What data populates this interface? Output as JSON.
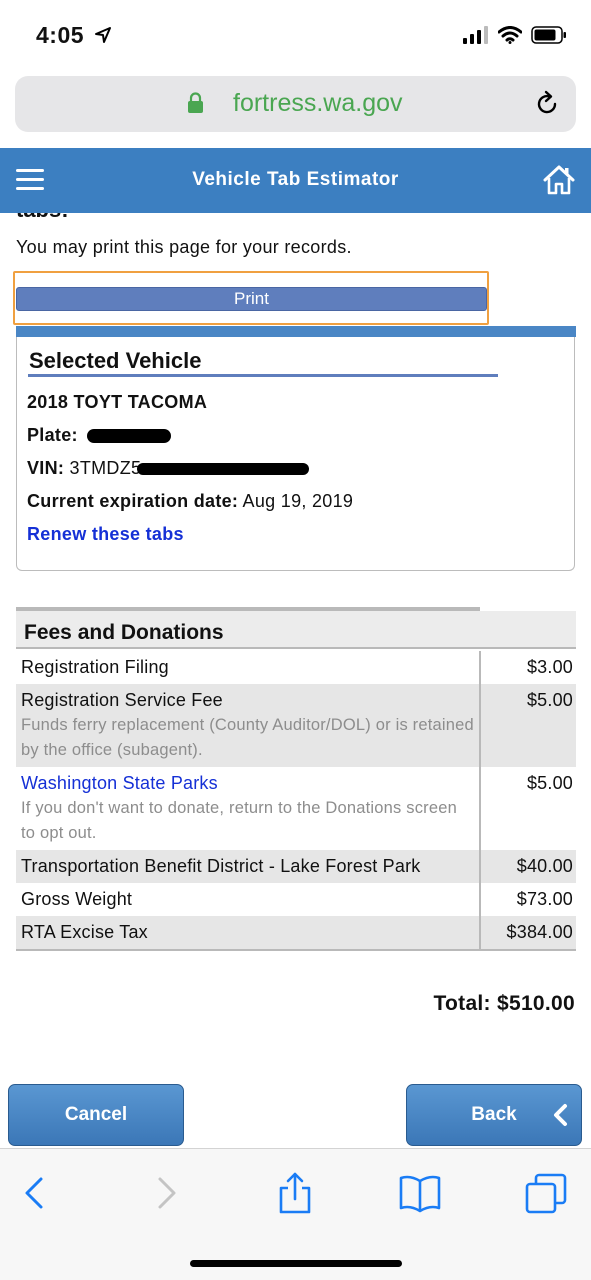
{
  "status_bar": {
    "time": "4:05"
  },
  "browser": {
    "url": "fortress.wa.gov"
  },
  "header": {
    "title": "Vehicle Tab Estimator"
  },
  "content": {
    "cut_off_text": "tabs:",
    "print_note": "You may print this page for your records.",
    "print_label": "Print"
  },
  "vehicle": {
    "section_title": "Selected Vehicle",
    "name": "2018 TOYT TACOMA",
    "plate_label": "Plate:",
    "vin_label": "VIN:",
    "vin_visible": "3TMDZ5",
    "expiration_label": "Current expiration date:",
    "expiration_value": "Aug 19, 2019",
    "renew_link": "Renew these tabs"
  },
  "fees": {
    "section_title": "Fees and Donations",
    "rows": [
      {
        "name": "Registration Filing",
        "note": "",
        "amount": "$3.00"
      },
      {
        "name": "Registration Service Fee",
        "note": "Funds ferry replacement (County Auditor/DOL) or is retained by the office (subagent).",
        "amount": "$5.00"
      },
      {
        "name": "Washington State Parks",
        "note": "If you don't want to donate, return to the Donations screen to opt out.",
        "amount": "$5.00"
      },
      {
        "name": "Transportation Benefit District - Lake Forest Park",
        "note": "",
        "amount": "$40.00"
      },
      {
        "name": "Gross Weight",
        "note": "",
        "amount": "$73.00"
      },
      {
        "name": "RTA Excise Tax",
        "note": "",
        "amount": "$384.00"
      }
    ],
    "total": "Total: $510.00"
  },
  "buttons": {
    "cancel": "Cancel",
    "back": "Back"
  },
  "colors": {
    "header_blue": "#3c7fc1",
    "link_blue": "#1530d6",
    "url_green": "#4aa651",
    "focus_orange": "#f0a040"
  }
}
